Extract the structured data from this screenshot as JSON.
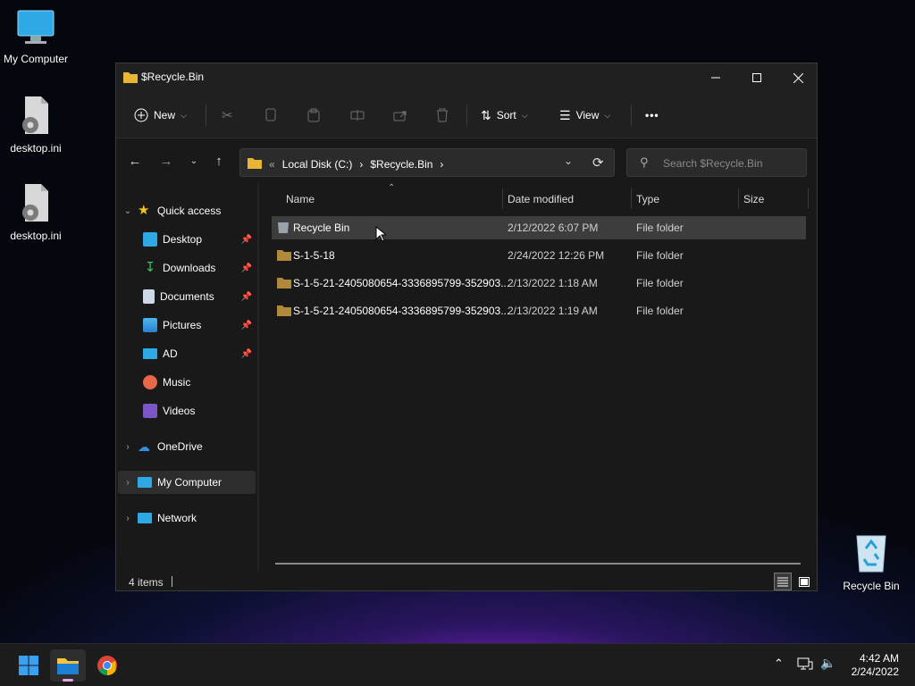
{
  "desktop": {
    "icons": [
      {
        "label": "My Computer"
      },
      {
        "label": "desktop.ini"
      },
      {
        "label": "desktop.ini"
      },
      {
        "label": "Recycle Bin"
      }
    ]
  },
  "window": {
    "title": "$Recycle.Bin",
    "toolbar": {
      "new_label": "New",
      "sort_label": "Sort",
      "view_label": "View",
      "more_label": "•••"
    },
    "address": {
      "overflow": "«",
      "crumbs": [
        "Local Disk (C:)",
        "$Recycle.Bin"
      ]
    },
    "search": {
      "placeholder": "Search $Recycle.Bin"
    },
    "sidebar": {
      "quick_access": "Quick access",
      "items": [
        {
          "label": "Desktop",
          "pinned": true
        },
        {
          "label": "Downloads",
          "pinned": true
        },
        {
          "label": "Documents",
          "pinned": true
        },
        {
          "label": "Pictures",
          "pinned": true
        },
        {
          "label": "AD",
          "pinned": true
        },
        {
          "label": "Music",
          "pinned": false
        },
        {
          "label": "Videos",
          "pinned": false
        }
      ],
      "onedrive": "OneDrive",
      "my_computer": "My Computer",
      "network": "Network"
    },
    "columns": {
      "name": "Name",
      "date": "Date modified",
      "type": "Type",
      "size": "Size"
    },
    "files": [
      {
        "name": "Recycle Bin",
        "date": "2/12/2022 6:07 PM",
        "type": "File folder",
        "size": ""
      },
      {
        "name": "S-1-5-18",
        "date": "2/24/2022 12:26 PM",
        "type": "File folder",
        "size": ""
      },
      {
        "name": "S-1-5-21-2405080654-3336895799-352903...",
        "date": "2/13/2022 1:18 AM",
        "type": "File folder",
        "size": ""
      },
      {
        "name": "S-1-5-21-2405080654-3336895799-352903...",
        "date": "2/13/2022 1:19 AM",
        "type": "File folder",
        "size": ""
      }
    ],
    "status": {
      "count": "4 items"
    }
  },
  "taskbar": {
    "time": "4:42 AM",
    "date": "2/24/2022"
  },
  "colors": {
    "folder": "#e8b534",
    "accent": "#0078d4"
  }
}
